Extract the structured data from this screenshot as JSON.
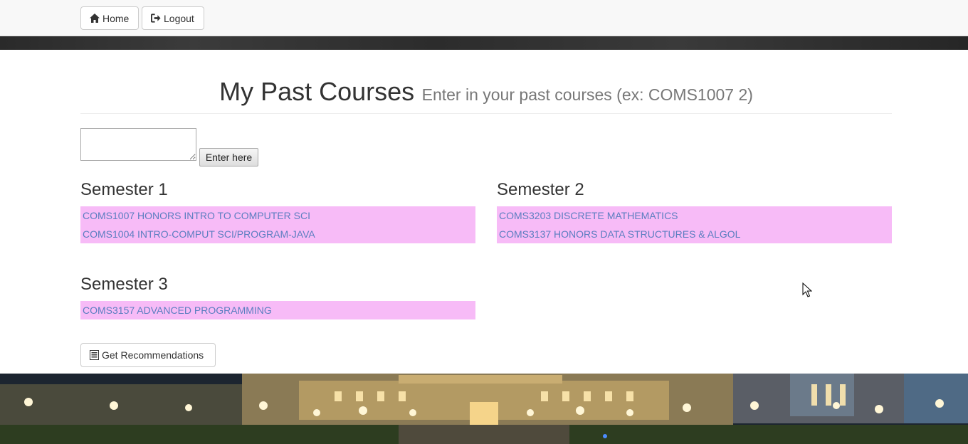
{
  "nav": {
    "home_label": "Home",
    "logout_label": "Logout"
  },
  "header": {
    "title": "My Past Courses",
    "subtitle": "Enter in your past courses (ex: COMS1007 2)"
  },
  "entry": {
    "input_value": "",
    "submit_label": "Enter here"
  },
  "semesters": [
    {
      "title": "Semester 1",
      "courses": [
        "COMS1007 HONORS INTRO TO COMPUTER SCI",
        "COMS1004 INTRO-COMPUT SCI/PROGRAM-JAVA"
      ]
    },
    {
      "title": "Semester 2",
      "courses": [
        "COMS3203 DISCRETE MATHEMATICS",
        "COMS3137 HONORS DATA STRUCTURES & ALGOL"
      ]
    },
    {
      "title": "Semester 3",
      "courses": [
        "COMS3157 ADVANCED PROGRAMMING"
      ]
    }
  ],
  "actions": {
    "recommend_label": "Get Recommendations"
  },
  "colors": {
    "course_highlight": "#f7bbf7",
    "course_text": "#5b7ec0"
  },
  "icons": {
    "home": "home-icon",
    "logout": "logout-icon",
    "recommend": "list-icon"
  }
}
